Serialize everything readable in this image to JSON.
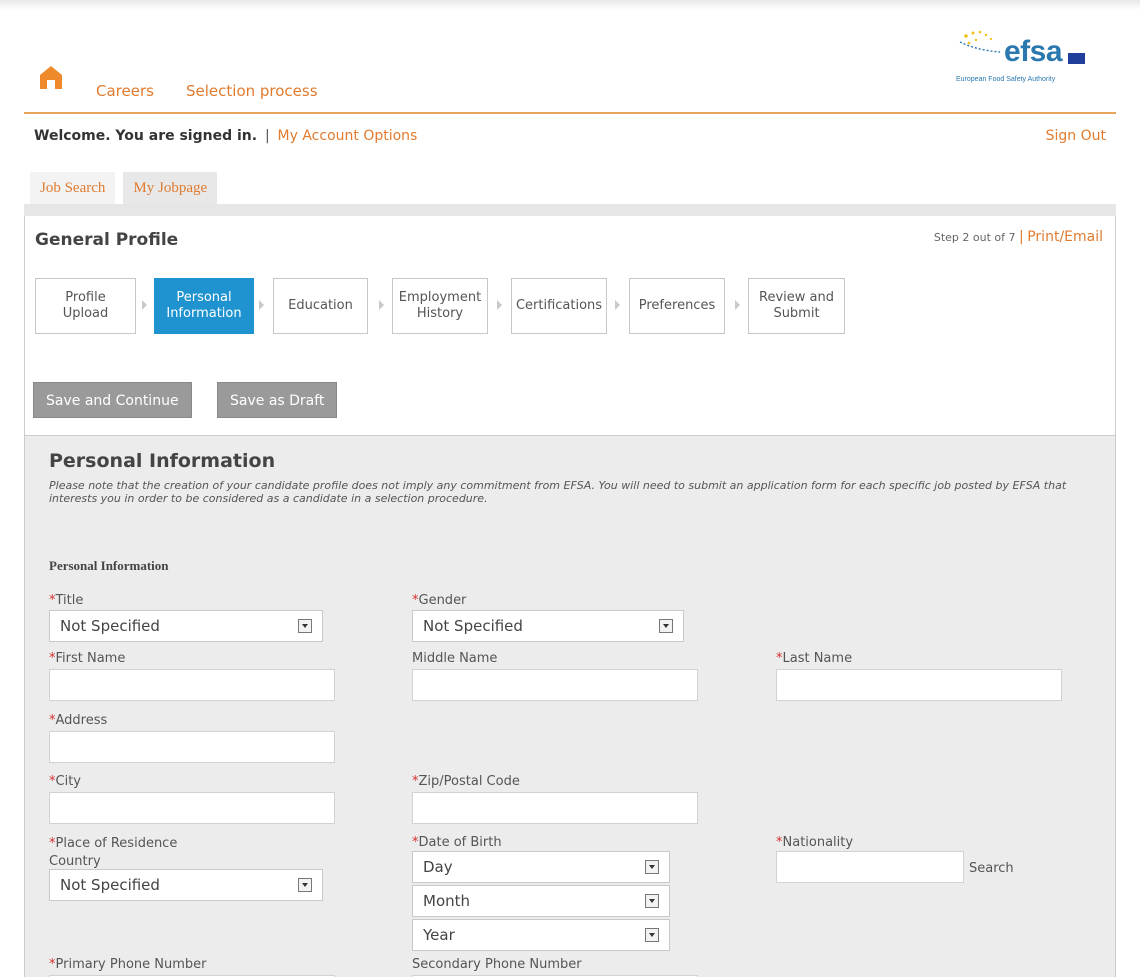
{
  "header": {
    "nav": [
      "Careers",
      "Selection process"
    ],
    "logo_word": "efsa",
    "logo_subtitle": "European Food Safety Authority",
    "welcome": "Welcome. You are signed in.",
    "separator": "|",
    "account_options": "My Account Options",
    "sign_out": "Sign Out"
  },
  "tabs": [
    "Job Search",
    "My Jobpage"
  ],
  "profile": {
    "title": "General Profile",
    "step_text": "Step 2 out of 7",
    "separator": "|",
    "print_email": "Print/Email",
    "steps": [
      "Profile Upload",
      "Personal Information",
      "Education",
      "Employment History",
      "Certifications",
      "Preferences",
      "Review and Submit"
    ],
    "active_step": 1,
    "save_continue": "Save and Continue",
    "save_draft": "Save as Draft"
  },
  "personal": {
    "title": "Personal Information",
    "note": "Please note that the creation of your candidate profile does not imply any commitment from EFSA. You will need to submit an application form for each specific job posted by EFSA that interests you in order to be considered as a candidate in a selection procedure.",
    "subtitle": "Personal Information",
    "required_mark": "*",
    "fields": {
      "title": {
        "label": "Title",
        "value": "Not Specified"
      },
      "gender": {
        "label": "Gender",
        "value": "Not Specified"
      },
      "first_name": {
        "label": "First Name"
      },
      "middle_name": {
        "label": "Middle Name"
      },
      "last_name": {
        "label": "Last Name"
      },
      "address": {
        "label": "Address"
      },
      "city": {
        "label": "City"
      },
      "zip": {
        "label": "Zip/Postal Code"
      },
      "residence": {
        "label": "Place of Residence",
        "label2": "Country",
        "value": "Not Specified"
      },
      "dob": {
        "label": "Date of Birth",
        "day": "Day",
        "month": "Month",
        "year": "Year"
      },
      "nationality": {
        "label": "Nationality",
        "search": "Search"
      },
      "primary_phone": {
        "label": "Primary Phone Number"
      },
      "secondary_phone": {
        "label": "Secondary Phone Number"
      }
    }
  }
}
